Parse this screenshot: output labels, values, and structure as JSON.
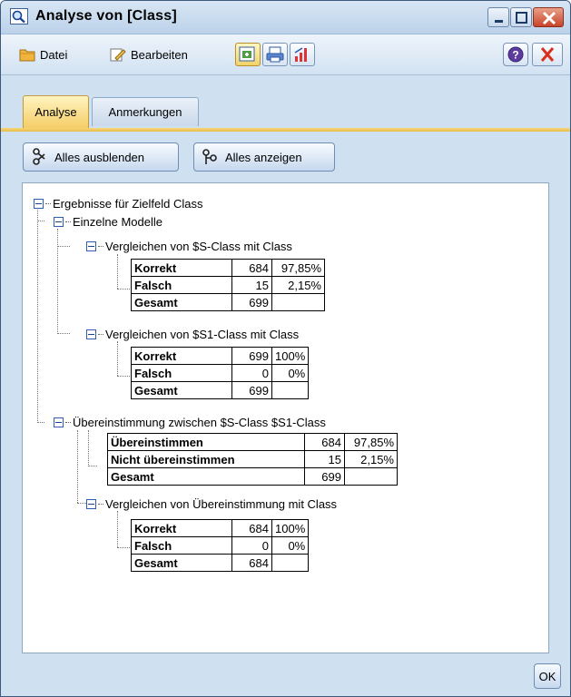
{
  "window": {
    "title": "Analyse von [Class]"
  },
  "menu": {
    "file": "Datei",
    "edit": "Bearbeiten"
  },
  "tabs": [
    {
      "label": "Analyse"
    },
    {
      "label": "Anmerkungen"
    }
  ],
  "actions": {
    "collapse_all": "Alles ausblenden",
    "expand_all": "Alles anzeigen"
  },
  "tree": {
    "root": "Ergebnisse für Zielfeld Class",
    "individual_models": "Einzelne Modelle",
    "compare_s": {
      "label": "Vergleichen von $S-Class mit Class",
      "rows": [
        {
          "label": "Korrekt",
          "count": "684",
          "pct": "97,85%"
        },
        {
          "label": "Falsch",
          "count": "15",
          "pct": "2,15%"
        },
        {
          "label": "Gesamt",
          "count": "699",
          "pct": ""
        }
      ]
    },
    "compare_s1": {
      "label": "Vergleichen von $S1-Class mit Class",
      "rows": [
        {
          "label": "Korrekt",
          "count": "699",
          "pct": "100%"
        },
        {
          "label": "Falsch",
          "count": "0",
          "pct": "0%"
        },
        {
          "label": "Gesamt",
          "count": "699",
          "pct": ""
        }
      ]
    },
    "agreement": {
      "label": "Übereinstimmung zwischen  $S-Class $S1-Class",
      "rows": [
        {
          "label": "Übereinstimmen",
          "count": "684",
          "pct": "97,85%"
        },
        {
          "label": "Nicht übereinstimmen",
          "count": "15",
          "pct": "2,15%"
        },
        {
          "label": "Gesamt",
          "count": "699",
          "pct": ""
        }
      ]
    },
    "compare_agreement": {
      "label": "Vergleichen von Übereinstimmung mit Class",
      "rows": [
        {
          "label": "Korrekt",
          "count": "684",
          "pct": "100%"
        },
        {
          "label": "Falsch",
          "count": "0",
          "pct": "0%"
        },
        {
          "label": "Gesamt",
          "count": "684",
          "pct": ""
        }
      ]
    }
  },
  "footer": {
    "ok": "OK"
  }
}
